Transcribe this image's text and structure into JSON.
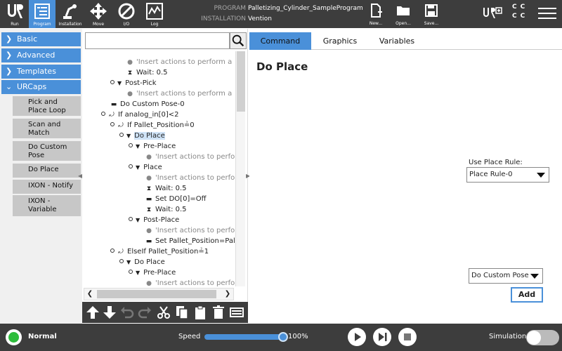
{
  "header": {
    "logo_label": "Run",
    "nav": [
      {
        "label": "Program",
        "icon": "program-icon"
      },
      {
        "label": "Installation",
        "icon": "robot-arm-icon"
      },
      {
        "label": "Move",
        "icon": "move-arrows-icon"
      },
      {
        "label": "I/O",
        "icon": "io-icon"
      },
      {
        "label": "Log",
        "icon": "log-chart-icon"
      }
    ],
    "program_label": "PROGRAM",
    "installation_label": "INSTALLATION",
    "program_name": "Palletizing_Cylinder_SampleProgram",
    "installation_name": "Vention",
    "file_buttons": [
      {
        "label": "New...",
        "icon": "new-file-icon"
      },
      {
        "label": "Open...",
        "icon": "open-folder-icon"
      },
      {
        "label": "Save...",
        "icon": "save-icon"
      }
    ],
    "cc_letters": [
      "C",
      "C",
      "C",
      "C"
    ]
  },
  "categories": [
    {
      "label": "Basic",
      "expanded": false
    },
    {
      "label": "Advanced",
      "expanded": false
    },
    {
      "label": "Templates",
      "expanded": false
    },
    {
      "label": "URCaps",
      "expanded": true
    }
  ],
  "urcaps_items": [
    "Pick and Place Loop",
    "Scan and Match",
    "Do Custom Pose",
    "Do Place",
    "IXON - Notify",
    "IXON - Variable"
  ],
  "search": {
    "placeholder": ""
  },
  "tree": [
    {
      "text": "'Insert actions to perform a",
      "kind": "comment"
    },
    {
      "text": "Wait: 0.5",
      "kind": "wait"
    },
    {
      "text": "Post-Pick",
      "kind": "folder"
    },
    {
      "text": "'Insert actions to perform a",
      "kind": "comment"
    },
    {
      "text": "Do Custom Pose-0",
      "kind": "command"
    },
    {
      "text": "If analog_in[0]<2",
      "kind": "if"
    },
    {
      "text": "If Pallet_Position≟0",
      "kind": "if"
    },
    {
      "text": "Do Place",
      "kind": "folder",
      "selected": true
    },
    {
      "text": "Pre-Place",
      "kind": "folder"
    },
    {
      "text": "'Insert actions to perfo",
      "kind": "comment"
    },
    {
      "text": "Place",
      "kind": "folder"
    },
    {
      "text": "'Insert actions to perfo",
      "kind": "comment"
    },
    {
      "text": "Wait: 0.5",
      "kind": "wait"
    },
    {
      "text": "Set DO[0]=Off",
      "kind": "command"
    },
    {
      "text": "Wait: 0.5",
      "kind": "wait"
    },
    {
      "text": "Post-Place",
      "kind": "folder"
    },
    {
      "text": "'Insert actions to perfo",
      "kind": "comment"
    },
    {
      "text": "Set Pallet_Position=Pal",
      "kind": "command"
    },
    {
      "text": "ElseIf Pallet_Position≟1",
      "kind": "if"
    },
    {
      "text": "Do Place",
      "kind": "folder"
    },
    {
      "text": "Pre-Place",
      "kind": "folder"
    },
    {
      "text": "'Insert actions to perfo",
      "kind": "comment"
    }
  ],
  "tabs": [
    "Command",
    "Graphics",
    "Variables"
  ],
  "active_tab": "Command",
  "page_title": "Do Place",
  "place_rule": {
    "label": "Use Place Rule:",
    "value": "Place Rule-0"
  },
  "pose_select": {
    "value": "Do Custom Pose"
  },
  "add_button": "Add",
  "footer": {
    "status": "Normal",
    "status_color": "#2ebd3c",
    "speed_label": "Speed",
    "speed_value": "100%",
    "speed_fraction": 1.0,
    "simulation_label": "Simulation",
    "simulation_on": false
  },
  "colors": {
    "accent": "#4a90d9",
    "header_bg": "#3d3d3d",
    "subitem_bg": "#c7c7c7"
  }
}
